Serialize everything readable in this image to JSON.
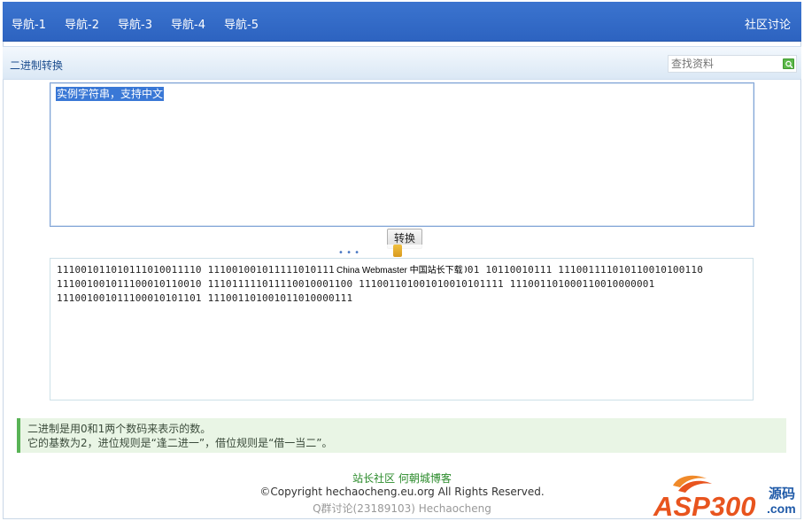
{
  "nav": {
    "items": [
      "导航-1",
      "导航-2",
      "导航-3",
      "导航-4",
      "导航-5"
    ],
    "right_link": "社区讨论"
  },
  "subheader": {
    "title": "二进制转换",
    "search_placeholder": "查找资料"
  },
  "input": {
    "text": "实例字符串，支持中文"
  },
  "convert_button": "转换",
  "watermark": "China Webmaster 中国站长下载",
  "output": {
    "lines": [
      "111001011010111010011110 111001001011111010111001001110010000111001001 10110010111 111001111010110010100110",
      "111001001011100010110010 111011111011110010001100 111001101001010010101111 111001101000110010000001",
      "111001001011100010101101 111001101001011010000111"
    ]
  },
  "info": {
    "line1": "二进制是用0和1两个数码来表示的数。",
    "line2": "它的基数为2，进位规则是“逢二进一”，借位规则是“借一当二”。"
  },
  "footer": {
    "link1": "站长社区",
    "link2": "何朝城博客",
    "copyright": "©Copyright hechaocheng.eu.org All Rights Reserved.",
    "qq": "Q群讨论(23189103) Hechaocheng"
  },
  "logo": {
    "main": "ASP300",
    "cn": "源码",
    "suffix": ".com"
  },
  "colors": {
    "nav_bg": "#2d63c0",
    "accent_green": "#59b356",
    "selection": "#3a78d6",
    "logo_orange": "#e8541e"
  }
}
